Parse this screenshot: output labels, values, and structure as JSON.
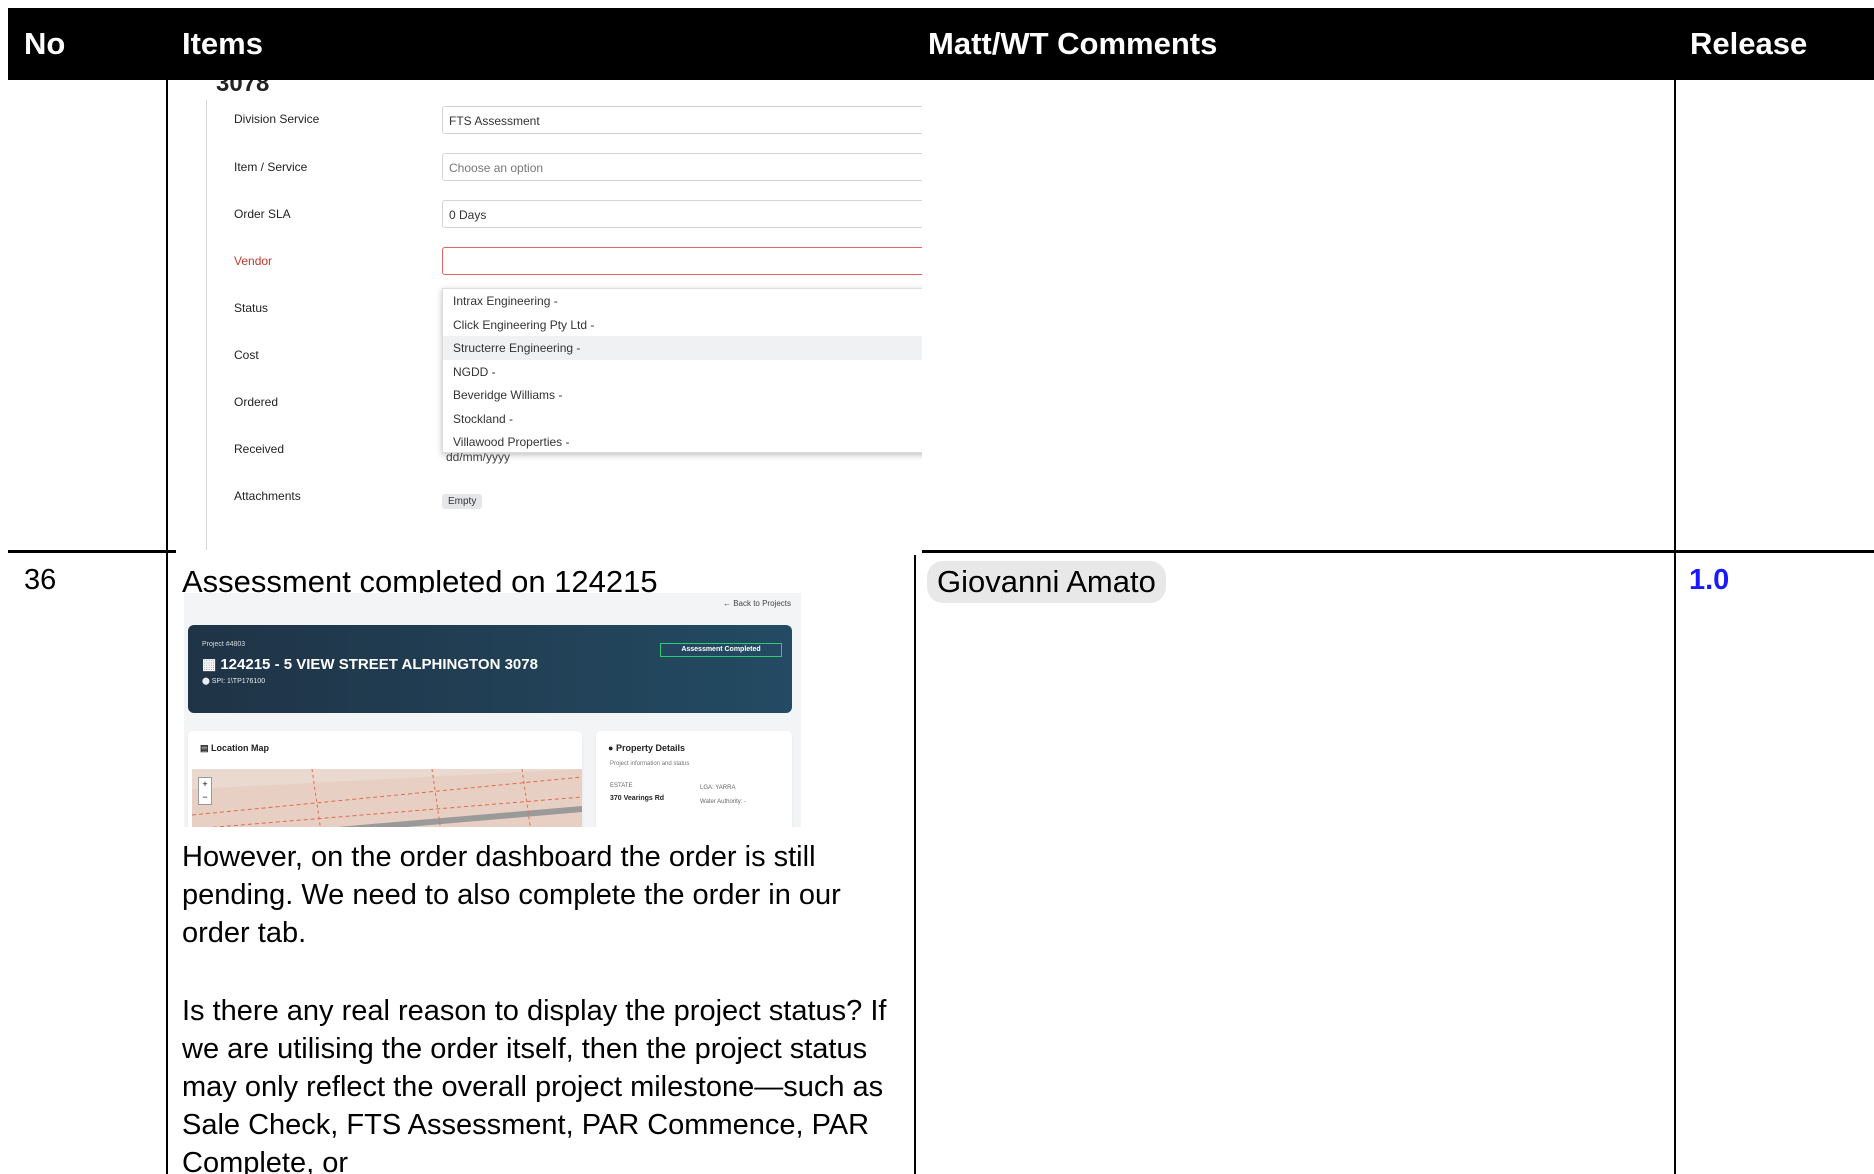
{
  "header": {
    "no": "No",
    "items": "Items",
    "comments": "Matt/WT Comments",
    "release": "Release"
  },
  "form": {
    "cut_text": "3078",
    "rows": [
      {
        "label": "Division Service",
        "value": "FTS Assessment"
      },
      {
        "label": "Item / Service",
        "value": "Choose an option"
      },
      {
        "label": "Order SLA",
        "value": "0 Days"
      },
      {
        "label": "Vendor",
        "value": ""
      },
      {
        "label": "Status"
      },
      {
        "label": "Cost"
      },
      {
        "label": "Ordered"
      },
      {
        "label": "Received"
      },
      {
        "label": "Attachments"
      }
    ],
    "vendor_options": [
      "Intrax Engineering -",
      "Click Engineering Pty Ltd -",
      "Structerre Engineering -",
      "NGDD -",
      "Beveridge Williams -",
      "Stockland -",
      "Villawood Properties -"
    ],
    "received_value": "dd/mm/yyyy",
    "attachments_badge": "Empty"
  },
  "row36": {
    "no": "36",
    "title": "Assessment completed on 124215",
    "comment": "Giovanni Amato",
    "release": "1.0",
    "project": {
      "back": "← Back to Projects",
      "project_number": "Project #4803",
      "address": "124215 - 5 VIEW STREET ALPHINGTON 3078",
      "spi": "SPI: 1\\TP176100",
      "status": "Assessment Completed",
      "location_map": "Location Map",
      "property_details": "Property Details",
      "property_sub": "Project information and status",
      "estate_label": "ESTATE",
      "estate_value": "370 Vearings Rd",
      "lga": "LGA: YARRA",
      "water": "Water Authority: -"
    },
    "para1": "However, on the order dashboard the order is still pending. We need to also complete the order in our order tab.",
    "para2": "Is there any real reason to display the project status? If we are utilising the order itself, then the project status may only reflect the overall project milestone—such as Sale Check, FTS Assessment, PAR Commence, PAR Complete, or"
  },
  "colors": {
    "header_bg": "#000000",
    "release_link": "#1a1aff",
    "banner": "#1f3346"
  }
}
